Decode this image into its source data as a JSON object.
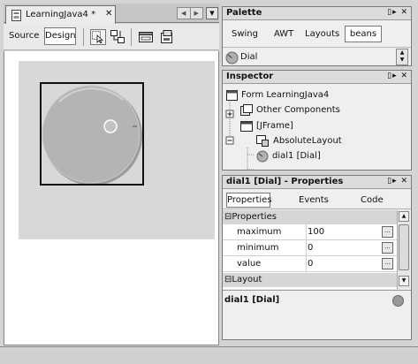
{
  "editor": {
    "tab_label": "LearningJava4 *",
    "close_glyph": "✕",
    "nav_prev": "◀",
    "nav_next": "▶",
    "menu_glyph": "▼",
    "source_label": "Source",
    "design_label": "Design",
    "icons": [
      "selection-mode-icon",
      "connection-mode-icon",
      "preview-design-icon",
      "customize-icon"
    ]
  },
  "palette": {
    "title": "Palette",
    "controls": "▯▸ ✕",
    "tabs": [
      "Swing",
      "AWT",
      "Layouts",
      "beans"
    ],
    "selected_tab": "beans",
    "item_label": "Dial"
  },
  "inspector": {
    "title": "Inspector",
    "controls": "▯▸ ✕",
    "tree": [
      {
        "label": "Form LearningJava4",
        "icon": "form-icon"
      },
      {
        "label": "Other Components",
        "icon": "components-folder-icon"
      },
      {
        "label": "[JFrame]",
        "icon": "jframe-icon"
      },
      {
        "label": "AbsoluteLayout",
        "icon": "layout-icon"
      },
      {
        "label": "dial1 [Dial]",
        "icon": "dial-bean-icon"
      }
    ]
  },
  "properties": {
    "title": "dial1 [Dial] - Properties",
    "controls": "▯▸ ✕",
    "tabs": [
      "Properties",
      "Events",
      "Code"
    ],
    "group_properties": "Properties",
    "group_layout": "Layout",
    "rows": [
      {
        "name": "maximum",
        "value": "100"
      },
      {
        "name": "minimum",
        "value": "0"
      },
      {
        "name": "value",
        "value": "0"
      }
    ],
    "ellipsis": "...",
    "description_title": "dial1 [Dial]"
  },
  "colors": {
    "dial_fill": "#b4b4b4",
    "form_background": "#d8d8d8",
    "pane_header": "#dcdcdc"
  }
}
